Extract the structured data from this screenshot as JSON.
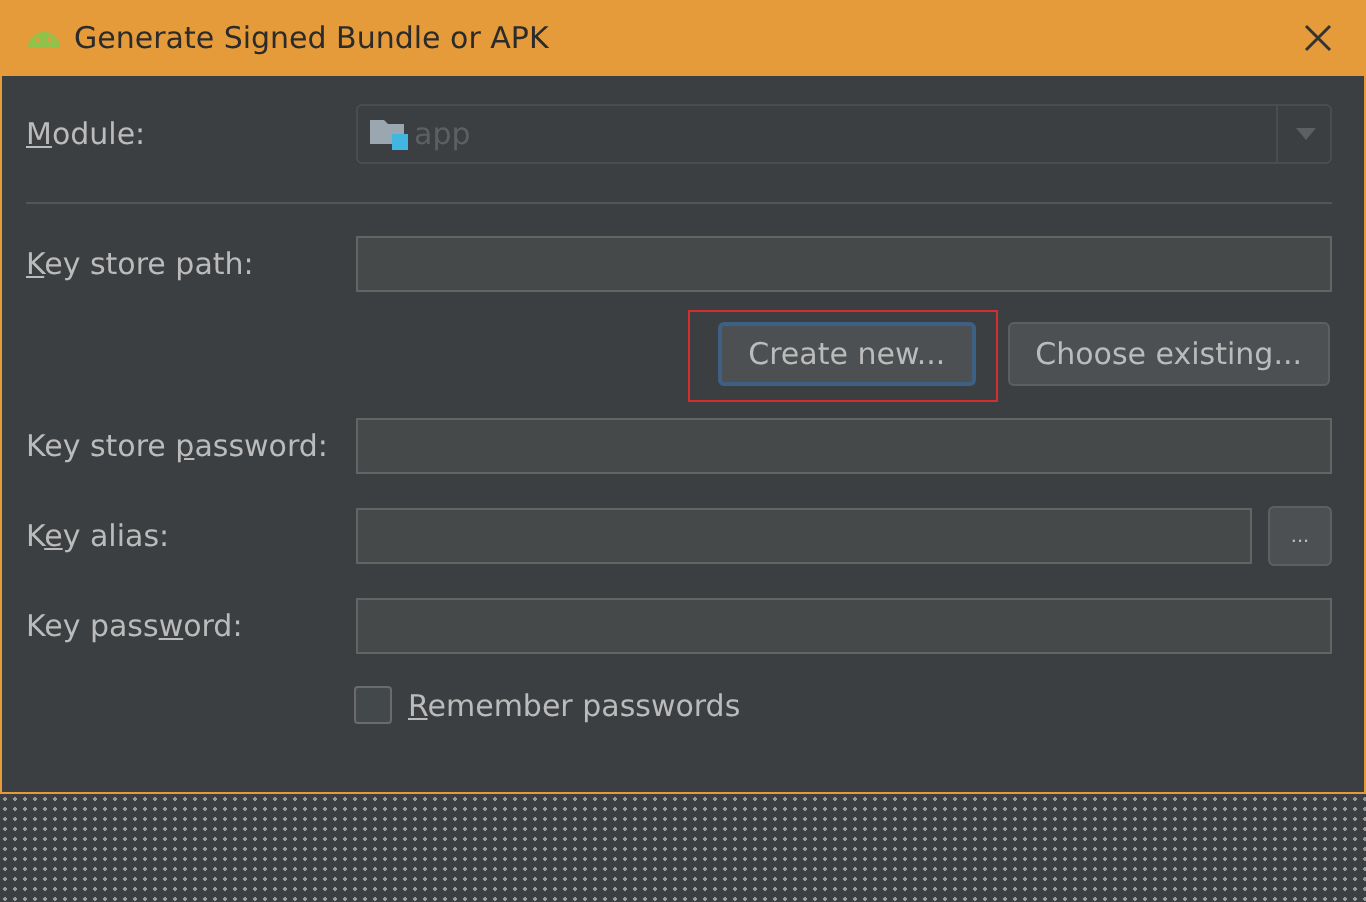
{
  "window": {
    "title": "Generate Signed Bundle or APK"
  },
  "module": {
    "label": {
      "key": "M",
      "post": "odule:"
    },
    "value": "app",
    "disabled": true
  },
  "fields": [
    {
      "kind": "text",
      "label": {
        "key": "K",
        "post": "ey store path:"
      }
    },
    {
      "kind": "buttons",
      "buttons": [
        {
          "label": "Create new...",
          "focused": true,
          "highlighted": true
        },
        {
          "label": "Choose existing...",
          "focused": false,
          "highlighted": false
        }
      ]
    },
    {
      "kind": "text",
      "label": {
        "pre": "Key store ",
        "key": "p",
        "post": "assword:"
      }
    },
    {
      "kind": "browse",
      "label": {
        "pre": "K",
        "key": "e",
        "post": "y alias:"
      },
      "button": "..."
    },
    {
      "kind": "text",
      "label": {
        "pre": "Key pass",
        "key": "w",
        "post": "ord:"
      }
    }
  ],
  "remember": {
    "label": {
      "key": "R",
      "post": "emember passwords"
    },
    "checked": false
  }
}
